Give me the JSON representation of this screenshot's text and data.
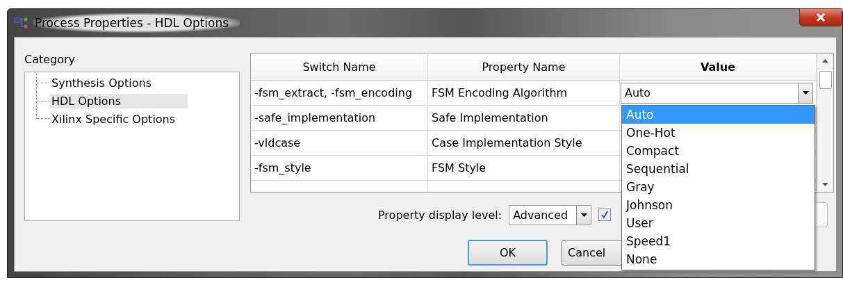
{
  "window": {
    "title": "Process Properties - HDL Options"
  },
  "category": {
    "label": "Category",
    "items": [
      {
        "label": "Synthesis Options",
        "selected": false
      },
      {
        "label": "HDL Options",
        "selected": true
      },
      {
        "label": "Xilinx Specific Options",
        "selected": false
      }
    ]
  },
  "table": {
    "columns": [
      {
        "label": "Switch Name",
        "active": false
      },
      {
        "label": "Property Name",
        "active": false
      },
      {
        "label": "Value",
        "active": true
      }
    ],
    "rows": [
      {
        "switch": "-fsm_extract, -fsm_encoding",
        "property": "FSM Encoding Algorithm",
        "value": "Auto"
      },
      {
        "switch": "-safe_implementation",
        "property": "Safe Implementation"
      },
      {
        "switch": "-vldcase",
        "property": "Case Implementation Style"
      },
      {
        "switch": "-fsm_style",
        "property": "FSM Style"
      }
    ]
  },
  "dropdown": {
    "options": [
      {
        "label": "Auto",
        "selected": true
      },
      {
        "label": "One-Hot",
        "selected": false
      },
      {
        "label": "Compact",
        "selected": false
      },
      {
        "label": "Sequential",
        "selected": false
      },
      {
        "label": "Gray",
        "selected": false
      },
      {
        "label": "Johnson",
        "selected": false
      },
      {
        "label": "User",
        "selected": false
      },
      {
        "label": "Speed1",
        "selected": false
      },
      {
        "label": "None",
        "selected": false
      }
    ]
  },
  "display_level": {
    "label": "Property display level:",
    "value": "Advanced",
    "checked": true
  },
  "buttons": [
    {
      "label": "OK",
      "default": true
    },
    {
      "label": "Cancel",
      "default": false
    }
  ]
}
